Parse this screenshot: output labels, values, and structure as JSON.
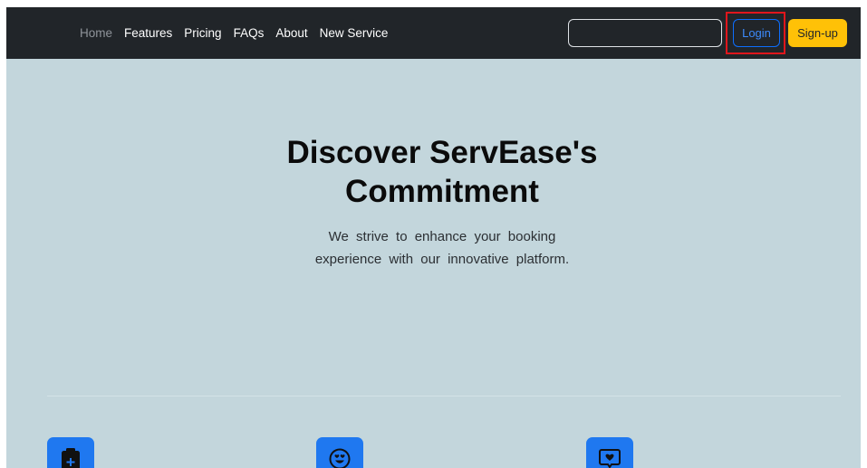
{
  "nav": {
    "items": [
      {
        "label": "Home",
        "active": true
      },
      {
        "label": "Features"
      },
      {
        "label": "Pricing"
      },
      {
        "label": "FAQs"
      },
      {
        "label": "About"
      },
      {
        "label": "New Service"
      }
    ],
    "search_value": "",
    "login_label": "Login",
    "signup_label": "Sign-up"
  },
  "hero": {
    "title": "Discover ServEase's Commitment",
    "subtitle": "We strive to enhance your booking experience with our innovative platform."
  },
  "features": {
    "icons": [
      "clipboard-plus-icon",
      "emoji-heart-eyes-icon",
      "chat-heart-icon"
    ]
  },
  "colors": {
    "navbar_bg": "#212529",
    "hero_bg": "#c3d6dc",
    "login_accent": "#0d6efd",
    "signup_bg": "#ffc107",
    "feature_icon_bg": "#1f78f0",
    "highlight_box": "#e0161c"
  }
}
